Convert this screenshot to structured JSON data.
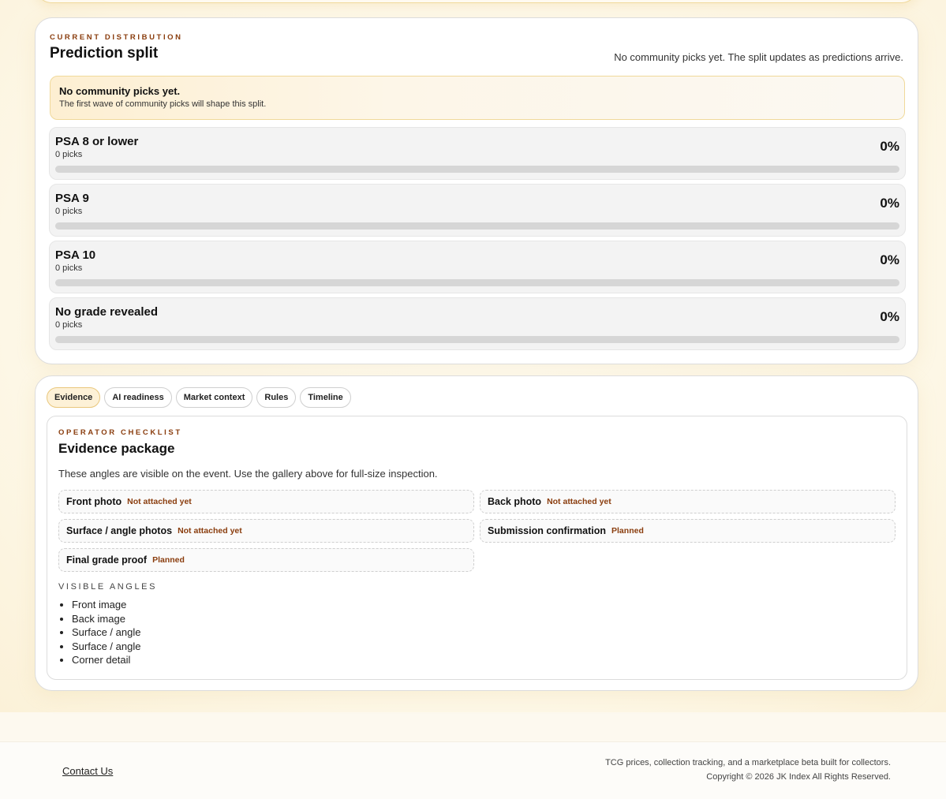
{
  "split": {
    "eyebrow": "CURRENT DISTRIBUTION",
    "title": "Prediction split",
    "note": "No community picks yet. The split updates as predictions arrive.",
    "notice": {
      "title": "No community picks yet.",
      "subtitle": "The first wave of community picks will shape this split."
    },
    "options": [
      {
        "label": "PSA 8 or lower",
        "picks": "0 picks",
        "percent": "0%",
        "fraction": 0
      },
      {
        "label": "PSA 9",
        "picks": "0 picks",
        "percent": "0%",
        "fraction": 0
      },
      {
        "label": "PSA 10",
        "picks": "0 picks",
        "percent": "0%",
        "fraction": 0
      },
      {
        "label": "No grade revealed",
        "picks": "0 picks",
        "percent": "0%",
        "fraction": 0
      }
    ]
  },
  "tabs": [
    {
      "label": "Evidence",
      "active": true
    },
    {
      "label": "AI readiness",
      "active": false
    },
    {
      "label": "Market context",
      "active": false
    },
    {
      "label": "Rules",
      "active": false
    },
    {
      "label": "Timeline",
      "active": false
    }
  ],
  "evidence": {
    "eyebrow": "OPERATOR CHECKLIST",
    "title": "Evidence package",
    "description": "These angles are visible on the event. Use the gallery above for full-size inspection.",
    "checklist": [
      {
        "label": "Front photo",
        "status": "Not attached yet"
      },
      {
        "label": "Back photo",
        "status": "Not attached yet"
      },
      {
        "label": "Surface / angle photos",
        "status": "Not attached yet"
      },
      {
        "label": "Submission confirmation",
        "status": "Planned"
      },
      {
        "label": "Final grade proof",
        "status": "Planned"
      }
    ],
    "angles_heading": "VISIBLE ANGLES",
    "angles": [
      "Front image",
      "Back image",
      "Surface / angle",
      "Surface / angle",
      "Corner detail"
    ]
  },
  "footer": {
    "contact": "Contact Us",
    "tagline": "TCG prices, collection tracking, and a marketplace beta built for collectors.",
    "copyright": "Copyright © 2026 JK Index All Rights Reserved."
  },
  "colors": {
    "accent": "#8a3d0e",
    "active_tab_bg": "#fdf1d7",
    "bar_track": "#d6d6d6"
  }
}
